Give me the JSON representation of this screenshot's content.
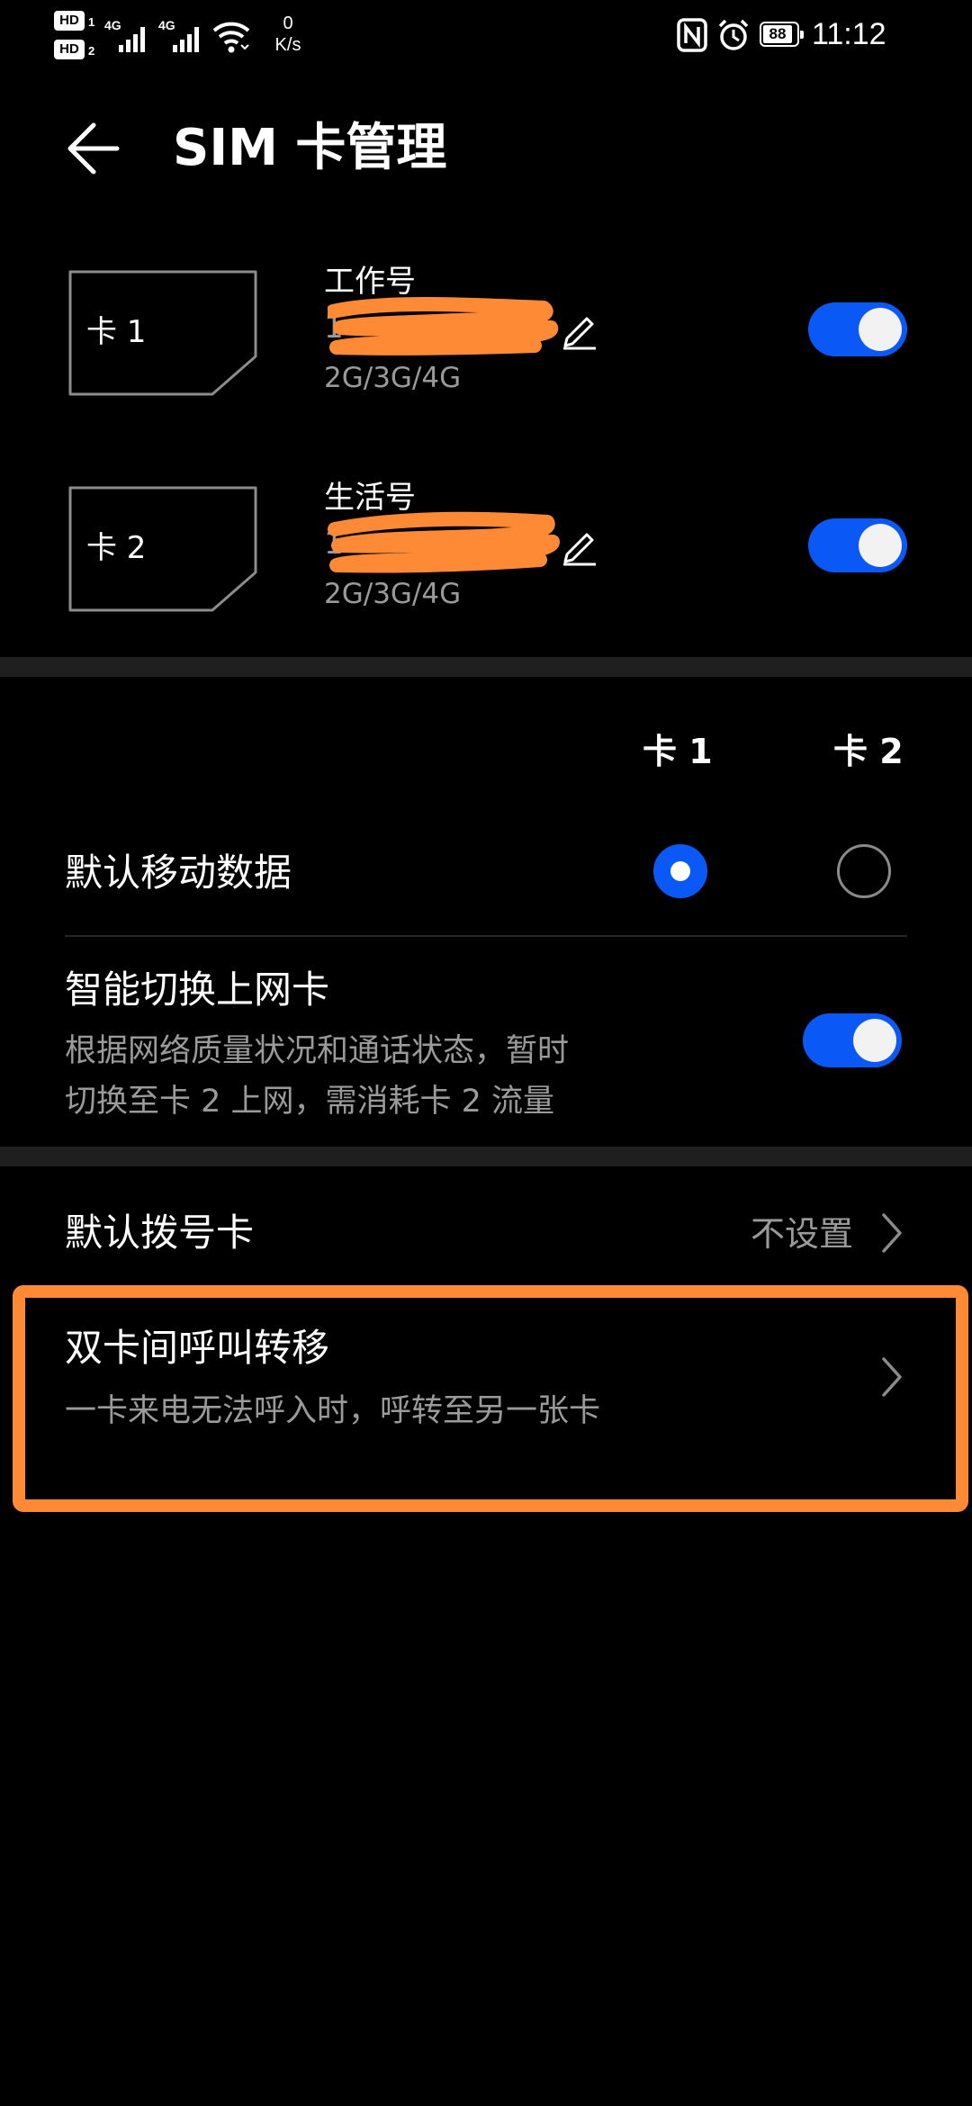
{
  "status_bar": {
    "hd_label": "HD",
    "sim1_slot": "1",
    "sim2_slot": "2",
    "network_type": "4G",
    "speed_value": "0",
    "speed_unit": "K/s",
    "battery": "88",
    "time": "11:12",
    "icons": [
      "hd-icon",
      "signal-icon",
      "wifi-icon",
      "nfc-icon",
      "alarm-icon",
      "battery-icon"
    ]
  },
  "header": {
    "title": "SIM 卡管理",
    "back_icon": "back-arrow-icon"
  },
  "sims": [
    {
      "icon_label": "卡 1",
      "name": "工作号",
      "network": "2G/3G/4G",
      "number_prefix": "1",
      "enabled": true
    },
    {
      "icon_label": "卡 2",
      "name": "生活号",
      "network": "2G/3G/4G",
      "number_prefix": "1",
      "enabled": true
    }
  ],
  "data_section": {
    "col1": "卡 1",
    "col2": "卡 2",
    "default_data_label": "默认移动数据",
    "default_data_selected": "卡 1",
    "smart_switch_title": "智能切换上网卡",
    "smart_switch_desc_line1": "根据网络质量状况和通话状态，暂时",
    "smart_switch_desc_line2": "切换至卡 2 上网，需消耗卡 2 流量",
    "smart_switch_enabled": true
  },
  "call_section": {
    "default_dial_label": "默认拨号卡",
    "default_dial_value": "不设置",
    "forward_title": "双卡间呼叫转移",
    "forward_desc": "一卡来电无法呼入时，呼转至另一张卡"
  },
  "colors": {
    "accent": "#0a59f7",
    "highlight": "#ff8a35",
    "redaction": "#ff8a35",
    "secondary_text": "#9a9a9a",
    "background": "#000000"
  }
}
